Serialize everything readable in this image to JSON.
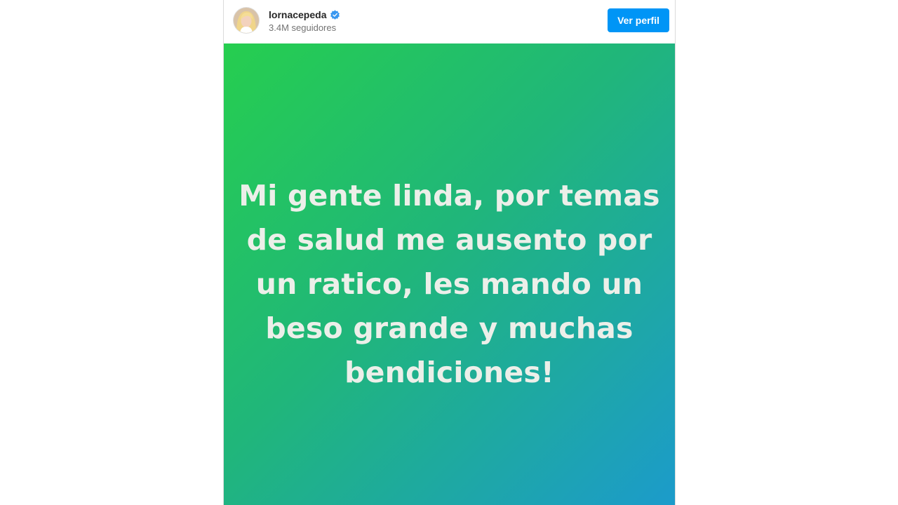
{
  "header": {
    "username": "lornacepeda",
    "verified": true,
    "followers": "3.4M seguidores",
    "view_profile_label": "Ver perfil",
    "avatar_icon": "profile-photo",
    "verified_icon": "verified-badge-icon"
  },
  "story": {
    "text": "Mi gente linda, por temas\nde salud me ausento por\nun ratico, les mando un\nbeso grande y muchas\nbendiciones!",
    "gradient_colors": [
      "#26ce4f",
      "#20b67a",
      "#1c9bcb"
    ],
    "text_color": "#ecefe9"
  },
  "colors": {
    "accent": "#0095f6",
    "verified": "#3897f0"
  }
}
